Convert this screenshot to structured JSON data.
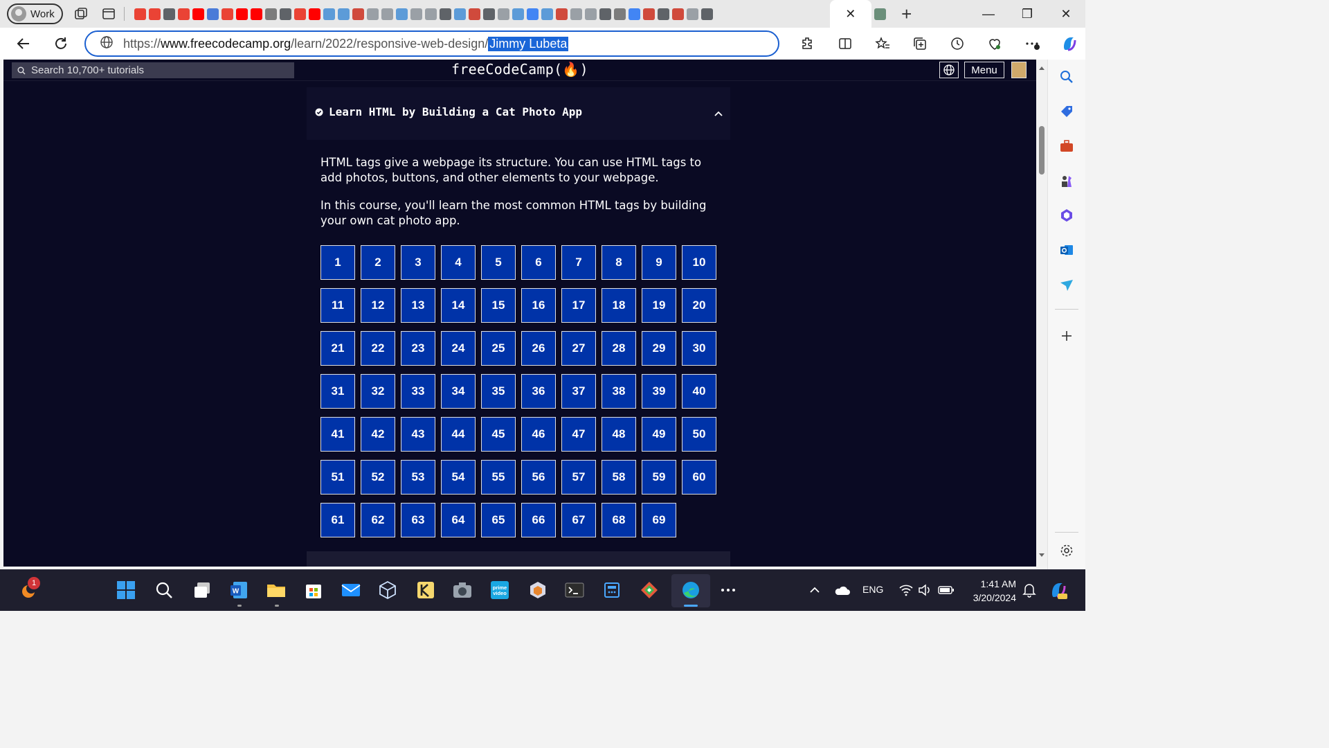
{
  "browser": {
    "profile_label": "Work",
    "tab_close_glyph": "✕",
    "new_tab_glyph": "+",
    "url_prefix": "https://",
    "url_host": "www.freecodecamp.org",
    "url_path": "/learn/2022/responsive-web-design/",
    "url_selected": "Jimmy Lubeta",
    "window_controls": [
      "—",
      "❐",
      "✕"
    ],
    "favicons": [
      "#ea4335",
      "#ea4335",
      "#5f6368",
      "#ea4335",
      "#ff0000",
      "#4a7bd8",
      "#ea4335",
      "#ff0000",
      "#ff0000",
      "#7c7c7c",
      "#5f6368",
      "#ea4335",
      "#ff0000",
      "#5c9bd8",
      "#5c9bd8",
      "#d04a3c",
      "#9aa0a6",
      "#9aa0a6",
      "#5c9bd8",
      "#9aa0a6",
      "#9aa0a6",
      "#5f6368",
      "#5c9bd8",
      "#d04a3c",
      "#5f6368",
      "#9aa0a6",
      "#5c9bd8",
      "#4285f4",
      "#5c9bd8",
      "#d04a3c",
      "#9aa0a6",
      "#9aa0a6",
      "#5f6368",
      "#7c7c7c",
      "#4285f4",
      "#d04a3c",
      "#5f6368",
      "#d04a3c",
      "#9aa0a6",
      "#5f6368"
    ]
  },
  "fcc": {
    "search_placeholder": "Search 10,700+ tutorials",
    "logo": "freeCodeCamp(🔥)",
    "menu_label": "Menu"
  },
  "block": {
    "title": "Learn HTML by Building a Cat Photo App",
    "description": [
      "HTML tags give a webpage its structure. You can use HTML tags to add photos, buttons, and other elements to your webpage.",
      "In this course, you'll learn the most common HTML tags by building your own cat photo app."
    ],
    "step_count": 69
  },
  "taskbar": {
    "notification_count": "1",
    "language": "ENG",
    "time": "1:41 AM",
    "date": "3/20/2024"
  }
}
